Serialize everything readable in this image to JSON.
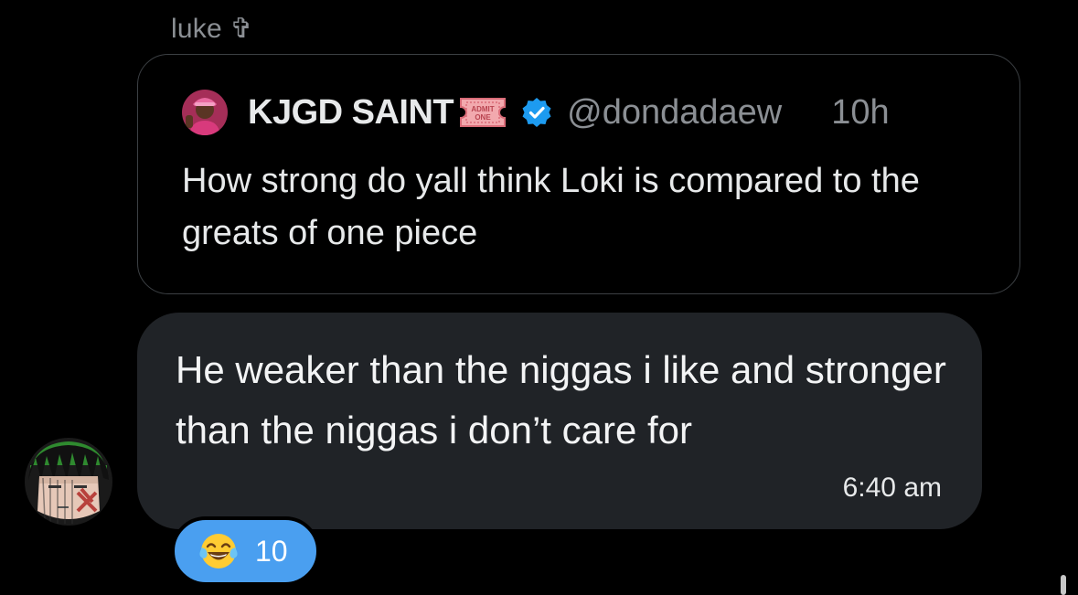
{
  "reply": {
    "sender_name": "luke ✞",
    "message_text": "He weaker than the niggas i like and stronger than the niggas i don’t care for",
    "time": "6:40 am",
    "avatar_icon": "cartoon-avatar-icon"
  },
  "quoted_post": {
    "author": "KJGD SAINT",
    "author_badge_icon": "admit-one-ticket-icon",
    "ticket_line1": "ADMIT",
    "ticket_line2": "ONE",
    "verified_icon": "verified-badge-icon",
    "handle": "@dondadaew",
    "age": "10h",
    "text": "How strong do yall think Loki is compared to the greats of one piece",
    "avatar_icon": "profile-avatar-icon"
  },
  "reaction": {
    "emoji_icon": "tears-of-joy-emoji-icon",
    "count": "10"
  },
  "colors": {
    "background": "#000000",
    "bubble": "#202327",
    "reaction_blue": "#4a9ff0",
    "verified_blue": "#1d9bf0",
    "muted_text": "#8b8f94"
  }
}
